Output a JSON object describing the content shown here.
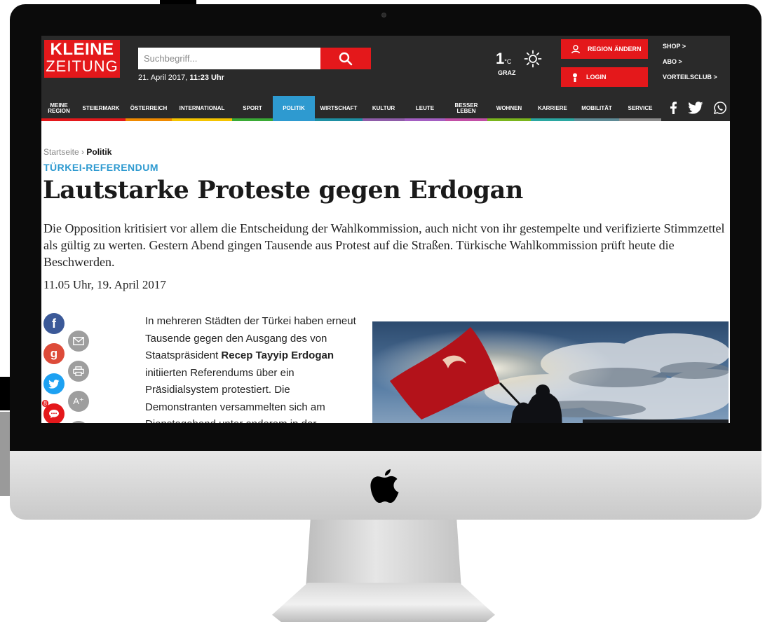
{
  "logo": {
    "line1": "KLEINE",
    "line2": "ZEITUNG"
  },
  "search": {
    "placeholder": "Suchbegriff..."
  },
  "date": {
    "day": "21. April 2017,",
    "time": "11:23 Uhr"
  },
  "weather": {
    "temp": "1",
    "unit": "°C",
    "city": "GRAZ",
    "icon": "sun-icon"
  },
  "header_buttons": {
    "region": "REGION ÄNDERN",
    "login": "LOGIN"
  },
  "header_links": [
    "SHOP >",
    "ABO >",
    "VORTEILSCLUB >"
  ],
  "nav": {
    "items": [
      {
        "label": "MEINE REGION",
        "color": "#e4181b"
      },
      {
        "label": "STEIERMARK",
        "color": "#e4181b"
      },
      {
        "label": "ÖSTERREICH",
        "color": "#f08a00"
      },
      {
        "label": "INTERNATIONAL",
        "color": "#f5c400"
      },
      {
        "label": "SPORT",
        "color": "#3aaa35"
      },
      {
        "label": "POLITIK",
        "color": "#2e9ad0"
      },
      {
        "label": "WIRTSCHAFT",
        "color": "#1d8fa3"
      },
      {
        "label": "KULTUR",
        "color": "#8e5ca8"
      },
      {
        "label": "LEUTE",
        "color": "#a35ec2"
      },
      {
        "label": "BESSER LEBEN",
        "color": "#c24fa5"
      },
      {
        "label": "WOHNEN",
        "color": "#7ab51d"
      },
      {
        "label": "KARRIERE",
        "color": "#2aa7a1"
      },
      {
        "label": "MOBILITÄT",
        "color": "#5f8b96"
      },
      {
        "label": "SERVICE",
        "color": "#8c8c8c"
      }
    ],
    "social": [
      "facebook-icon",
      "twitter-icon",
      "whatsapp-icon"
    ]
  },
  "article": {
    "breadcrumb_home": "Startseite",
    "breadcrumb_sep": "›",
    "breadcrumb_current": "Politik",
    "kicker": "TÜRKEI-REFERENDUM",
    "title": "Lautstarke Proteste gegen Erdogan",
    "lead": "Die Opposition kritisiert vor allem die Entscheidung der Wahlkommission, auch nicht von ihr gestempelte und verifizierte Stimmzettel als gültig zu werten. Gestern Abend gingen Tausende aus Protest auf die Straßen. Türkische Wahlkommission prüft heute die Beschwerden.",
    "published": "11.05 Uhr, 19. April 2017",
    "body_1": "In mehreren Städten der Türkei haben erneut Tausende gegen den Ausgang des von Staatspräsident ",
    "body_bold": "Recep Tayyip Erdogan",
    "body_2": " initiierten Referendums über ein Präsidialsystem protestiert. Die Demonstranten versammelten sich am Dienstagabend unter anderem in der",
    "comment_count": "8"
  },
  "share": {
    "facebook": "f",
    "googleplus": "g",
    "font_size": "A⁺"
  }
}
